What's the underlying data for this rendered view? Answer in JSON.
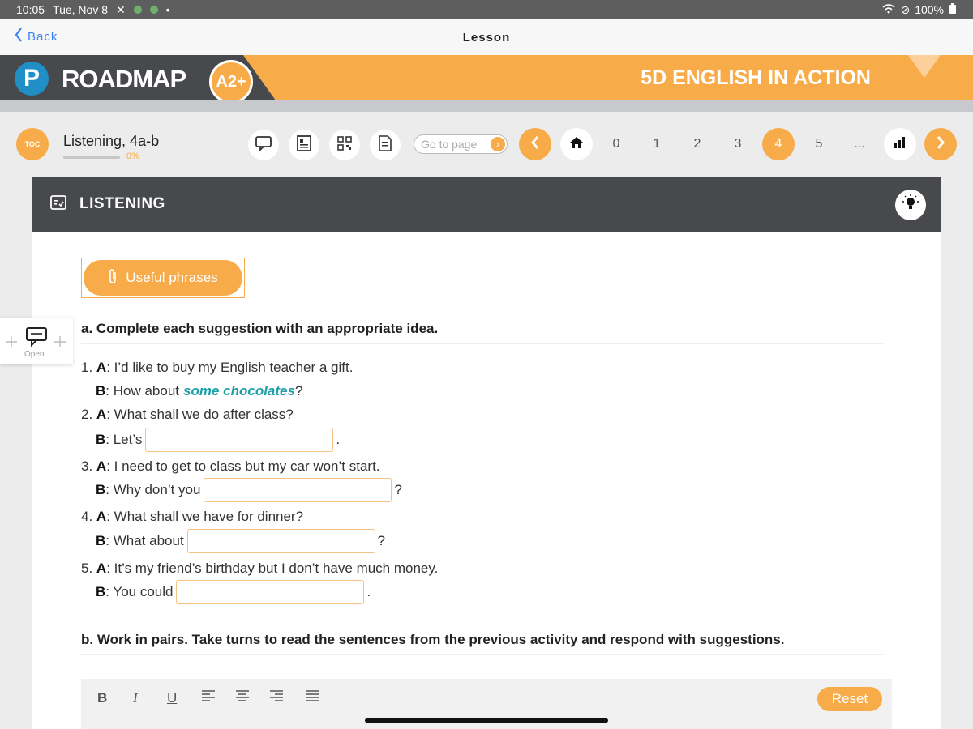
{
  "status_bar": {
    "time": "10:05",
    "date": "Tue, Nov 8",
    "battery": "100%"
  },
  "nav": {
    "back_label": "Back",
    "title": "Lesson"
  },
  "banner": {
    "logo_letter": "P",
    "brand": "ROADMAP",
    "level": "A2+",
    "unit_title": "5D ENGLISH IN ACTION"
  },
  "toolbar": {
    "toc_label": "TOC",
    "lesson_name": "Listening, 4a-b",
    "progress": "0%",
    "progress_fraction": 0,
    "goto_placeholder": "Go to page",
    "pages": [
      "0",
      "1",
      "2",
      "3",
      "4",
      "5",
      "..."
    ],
    "active_page": "4"
  },
  "card": {
    "header_title": "LISTENING",
    "useful_phrases": "Useful phrases",
    "section_a": "a. Complete each suggestion with an appropriate idea.",
    "items": [
      {
        "num": "1.",
        "a_label": "A",
        "a_text": ": I’d like to buy my English teacher a gift.",
        "b_label": "B",
        "b_text": ": How about",
        "b_answer": "some chocolates",
        "b_end": "?"
      },
      {
        "num": "2.",
        "a_label": "A",
        "a_text": ": What shall we do after class?",
        "b_label": "B",
        "b_text": ": Let’s",
        "b_end": "."
      },
      {
        "num": "3.",
        "a_label": "A",
        "a_text": ": I need to get to class but my car won’t start.",
        "b_label": "B",
        "b_text": ": Why don’t you",
        "b_end": "?"
      },
      {
        "num": "4.",
        "a_label": "A",
        "a_text": ": What shall we have for dinner?",
        "b_label": "B",
        "b_text": ": What about",
        "b_end": "?"
      },
      {
        "num": "5.",
        "a_label": "A",
        "a_text": ": It’s my friend’s birthday but I don’t have much money.",
        "b_label": "B",
        "b_text": ": You could",
        "b_end": "."
      }
    ],
    "section_b": "b. Work in pairs. Take turns to read the sentences from the previous activity and respond with suggestions.",
    "editor": {
      "bold": "B",
      "italic": "I",
      "underline": "U",
      "reset_label": "Reset"
    }
  },
  "floating_panel": {
    "label": "Open"
  }
}
